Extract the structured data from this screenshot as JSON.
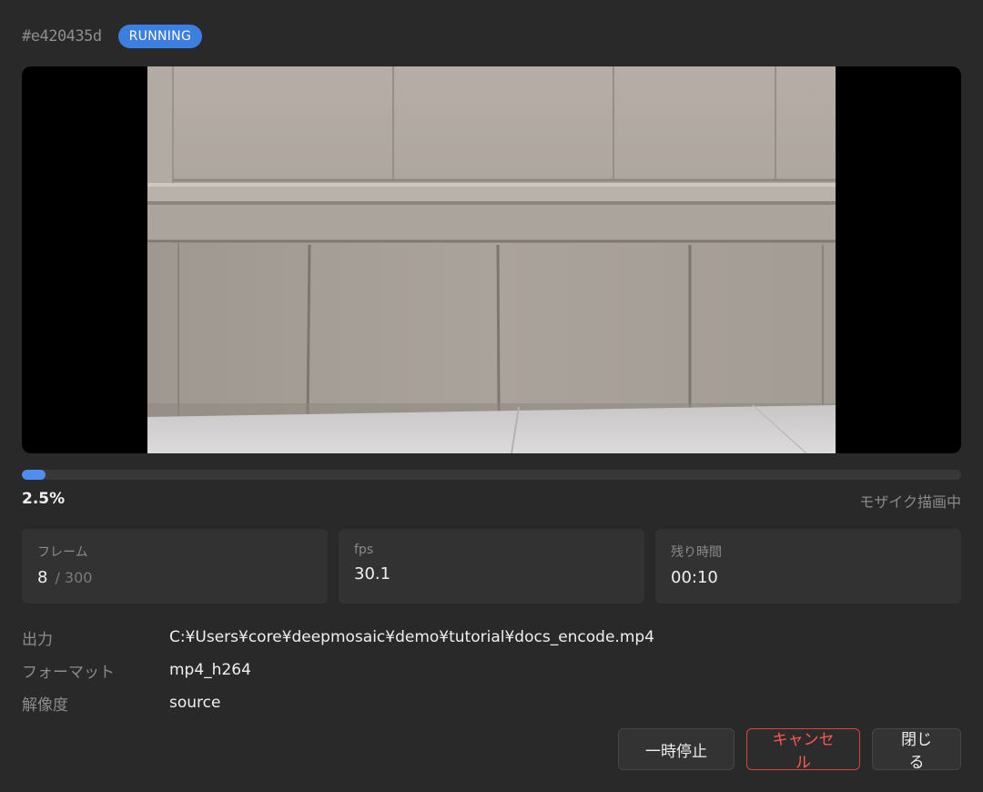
{
  "job": {
    "id": "#e420435d",
    "status": "RUNNING",
    "status_color": "#3d7fe0"
  },
  "progress": {
    "percent_label": "2.5%",
    "fraction": 0.025,
    "stage": "モザイク描画中",
    "color": "#4f8df0"
  },
  "stats": {
    "frames": {
      "label": "フレーム",
      "value": "8",
      "total": "/ 300"
    },
    "fps": {
      "label": "fps",
      "value": "30.1"
    },
    "remaining": {
      "label": "残り時間",
      "value": "00:10"
    }
  },
  "info": {
    "output_label": "出力",
    "output_value": "C:¥Users¥core¥deepmosaic¥demo¥tutorial¥docs_encode.mp4",
    "format_label": "フォーマット",
    "format_value": "mp4_h264",
    "resolution_label": "解像度",
    "resolution_value": "source"
  },
  "actions": {
    "pause": "一時停止",
    "cancel": "キャンセル",
    "close": "閉じる",
    "cancel_color": "#d9443f"
  }
}
